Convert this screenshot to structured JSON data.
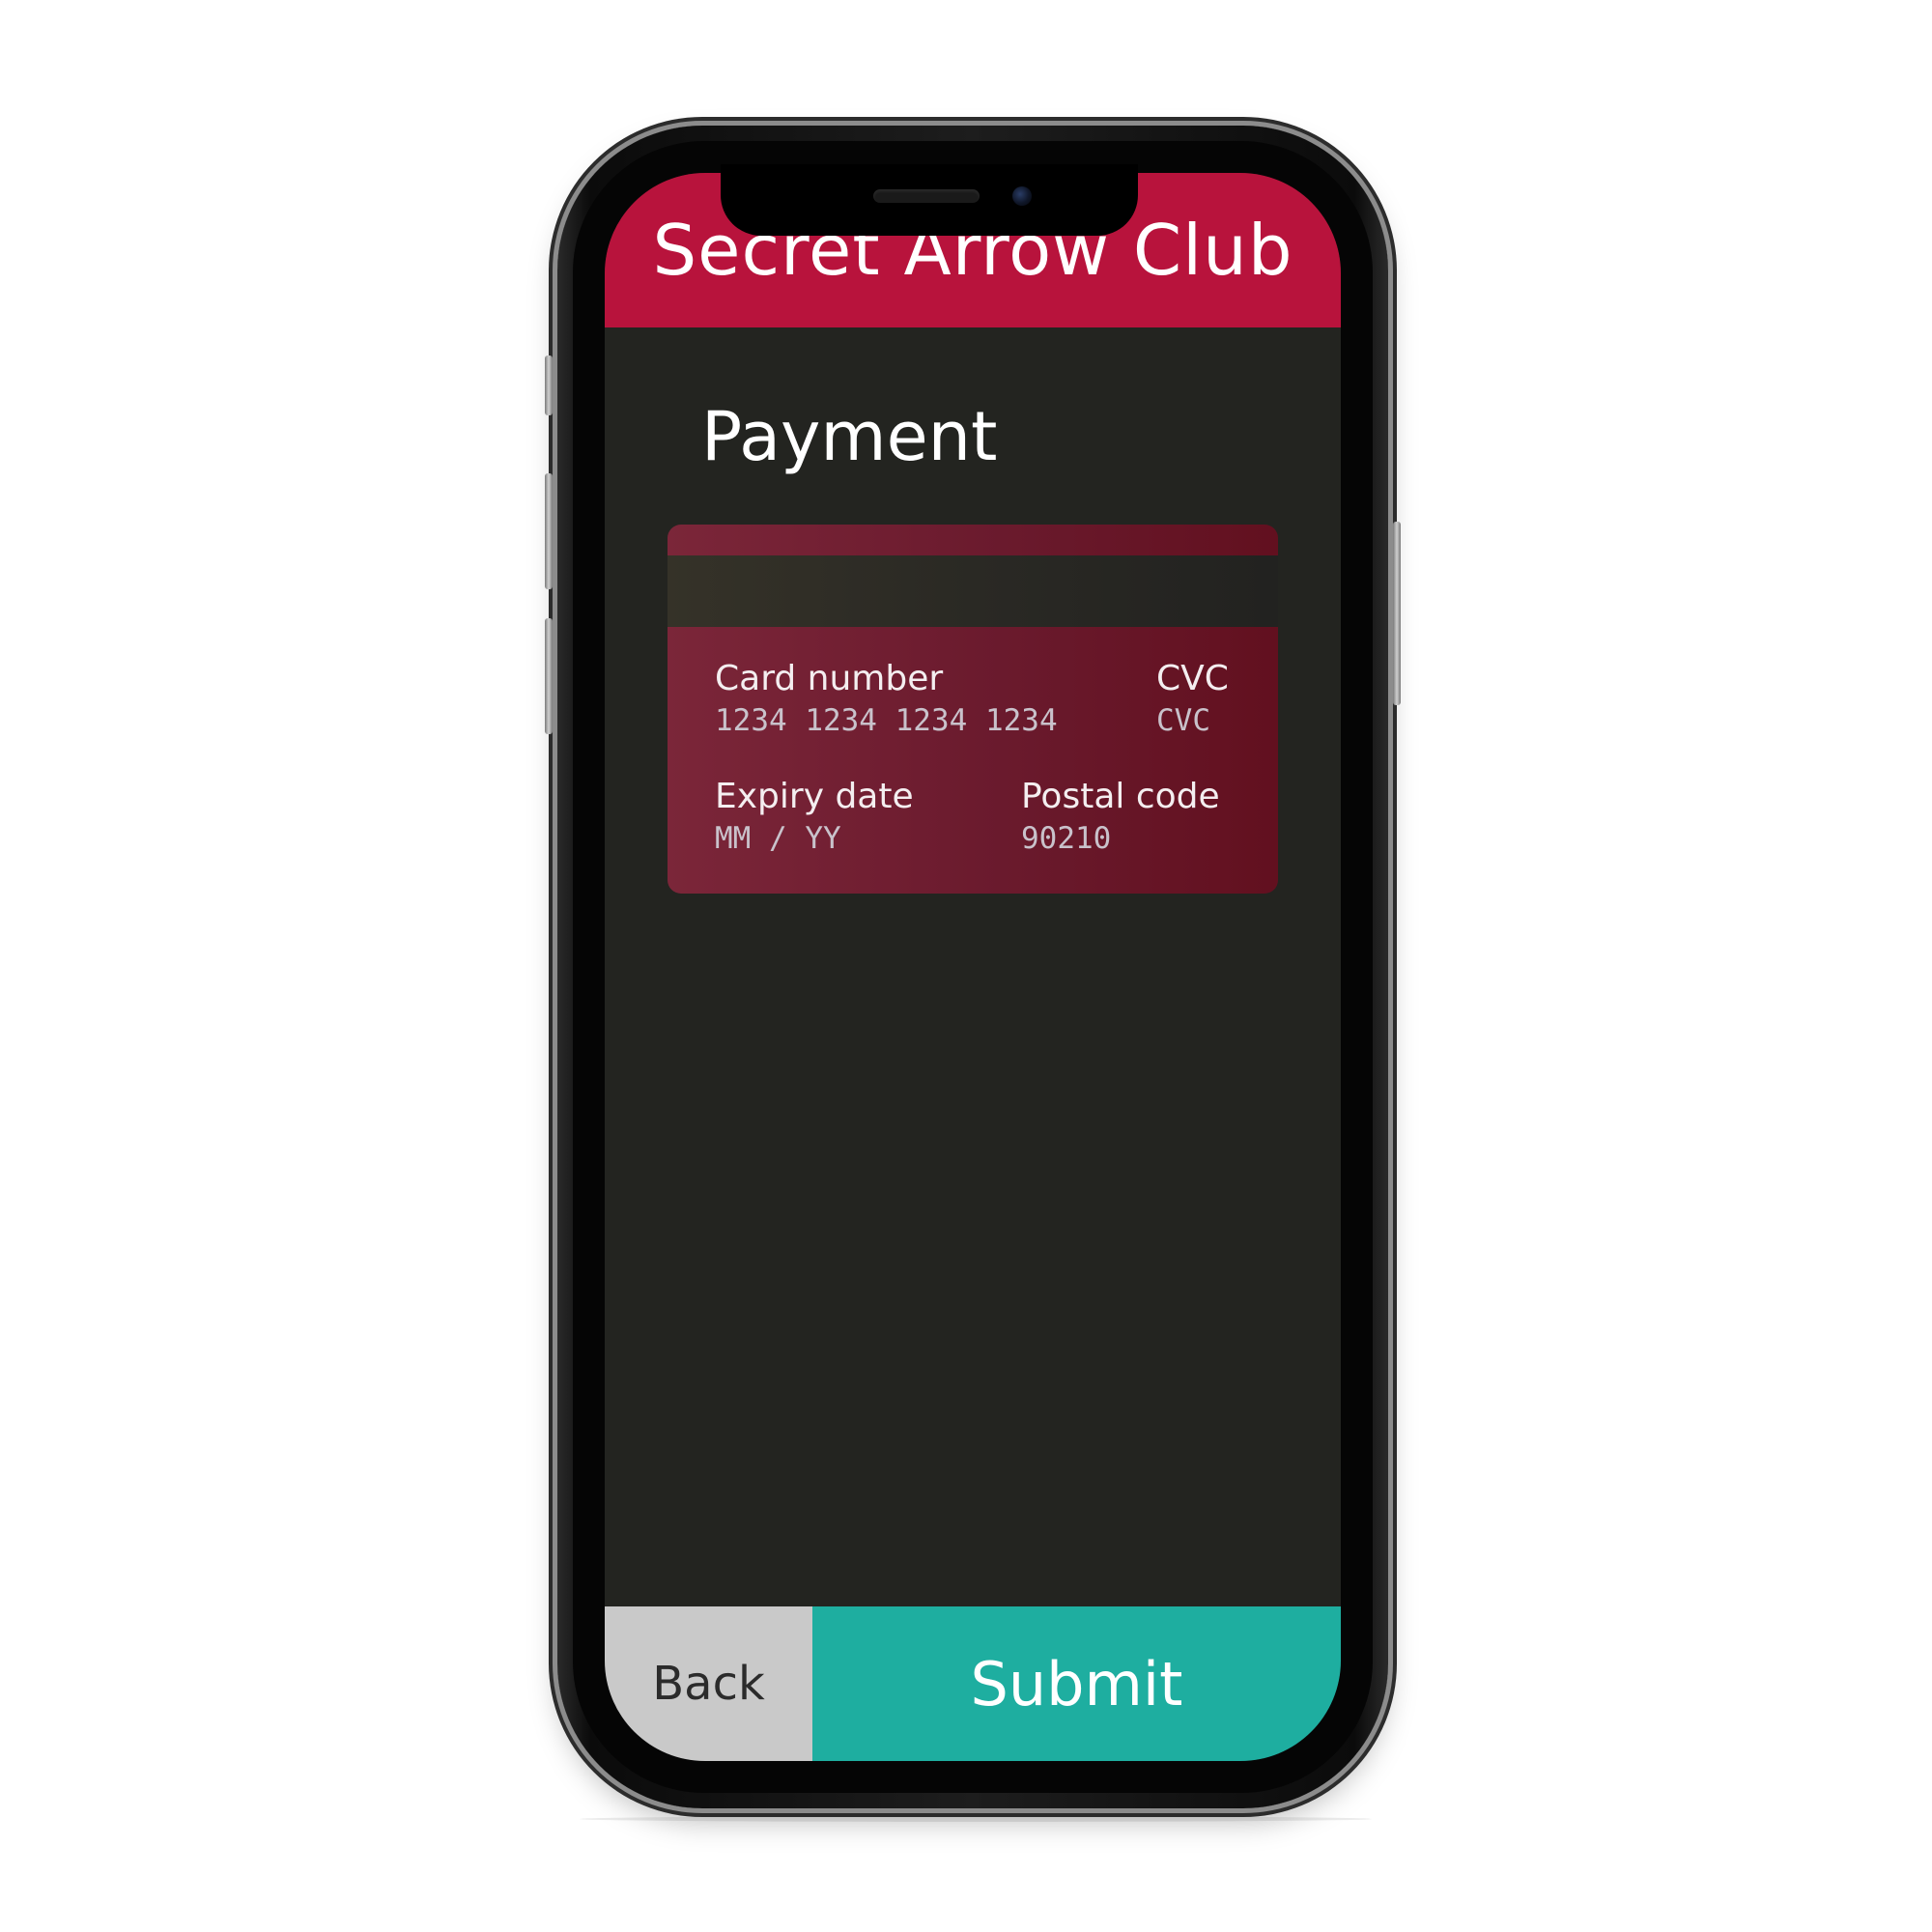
{
  "app": {
    "title": "Secret Arrow Club",
    "accent_color": "#b8133c",
    "background_color": "#232420"
  },
  "page": {
    "title": "Payment"
  },
  "card_form": {
    "card_number": {
      "label": "Card number",
      "placeholder": "1234 1234 1234 1234"
    },
    "cvc": {
      "label": "CVC",
      "placeholder": "CVC"
    },
    "expiry": {
      "label": "Expiry date",
      "placeholder": "MM / YY"
    },
    "postal": {
      "label": "Postal code",
      "placeholder": "90210"
    }
  },
  "footer": {
    "back_label": "Back",
    "submit_label": "Submit",
    "back_color": "#c9c9c9",
    "submit_color": "#1eaea0"
  },
  "icons": {
    "camera": "front-camera-icon",
    "speaker": "earpiece-speaker-icon"
  }
}
